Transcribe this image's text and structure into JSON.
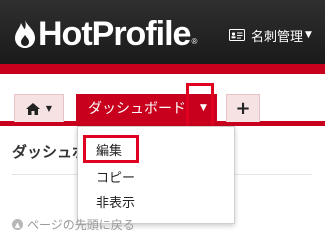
{
  "header": {
    "logo_text": "HotProfile",
    "logo_reg": "®",
    "business_card_menu_label": "名刺管理"
  },
  "tabs": {
    "home_caret": "▼",
    "dashboard_label": "ダッシュボード",
    "dashboard_caret": "▼",
    "add_label": "+"
  },
  "page": {
    "title": "ダッシュボード"
  },
  "dropdown": {
    "items": [
      "編集",
      "コピー",
      "非表示"
    ]
  },
  "footer": {
    "back_to_top": "ページの先頭に戻る"
  },
  "colors": {
    "accent": "#c8001e",
    "highlight": "#e00020"
  }
}
